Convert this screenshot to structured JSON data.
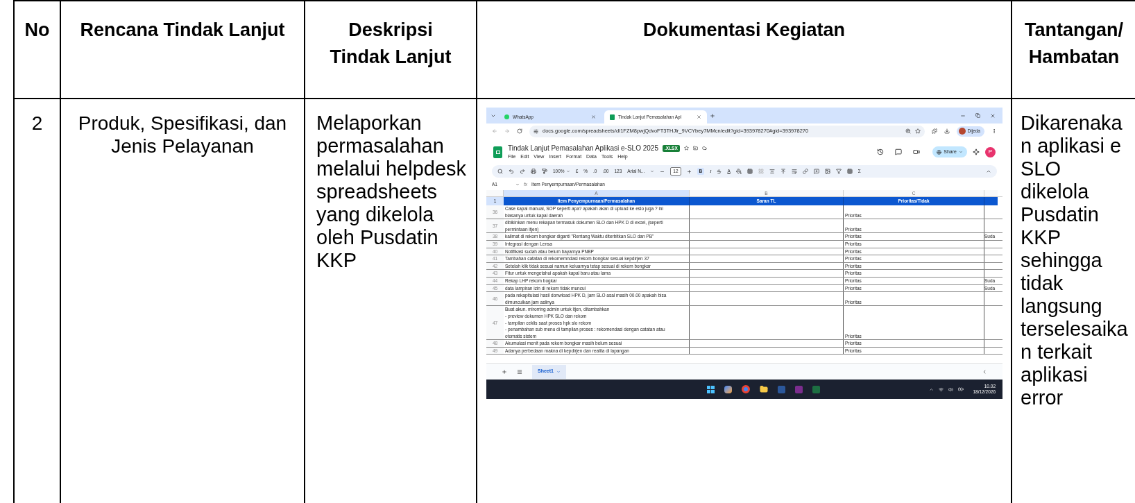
{
  "table": {
    "columns": [
      {
        "label": "No"
      },
      {
        "label": "Rencana Tindak Lanjut"
      },
      {
        "label": "Deskripsi Tindak Lanjut"
      },
      {
        "label": "Dokumentasi Kegiatan"
      },
      {
        "label": "Tantangan/ Hambatan"
      }
    ],
    "rows": [
      {
        "no": "2",
        "rencana": "Produk, Spesifikasi, dan Jenis Pelayanan",
        "deskripsi": "Melaporkan permasalahan melalui helpdesk spreadsheets yang dikelola oleh Pusdatin KKP",
        "tantangan": "Dikarenakan aplikasi e SLO dikelola Pusdatin KKP sehingga tidak langsung terselesaikan terkait aplikasi error",
        "screenshot": {
          "browser_tabs": [
            {
              "title": "WhatsApp",
              "selected": false
            },
            {
              "title": "Tindak Lanjut Pemasalahan Apl",
              "selected": true
            }
          ],
          "url": "docs.google.com/spreadsheets/d/1FZM8pwjQdvoFT3THJlr_9VCYbey7MMcn/edit?gid=393978270#gid=393978270",
          "profile": "Dijeda",
          "doc_title": "Tindak Lanjut Pemasalahan Aplikasi e-SLO 2025",
          "badge": ".XLSX",
          "menu": [
            "File",
            "Edit",
            "View",
            "Insert",
            "Format",
            "Data",
            "Tools",
            "Help"
          ],
          "share": "Share",
          "avatar": "P",
          "toolbar": {
            "zoom": "100%",
            "currency": "£",
            "percent": "%",
            "decrease_decimal": ".0",
            "increase_decimal": ".00",
            "number_format": "123",
            "font": "Arial N...",
            "font_size": "12",
            "bold": "B",
            "italic": "I",
            "text_color": "A",
            "sum": "Σ"
          },
          "cell_ref": "A1",
          "fx": "fx",
          "formula": "Item Penyempurnaan/Permasalahan",
          "column_letters": [
            "A",
            "B",
            "C"
          ],
          "header": {
            "row": "1",
            "cells": [
              "Item Penyempurnaan/Permasalahan",
              "Saran TL",
              "Prioritas/Tidak"
            ]
          },
          "rows": [
            {
              "num": "36",
              "item": "Case kapal manual, SOP seperti apa? apakah akan di upload ke eslo juga ? ini\nbiasanya untuk kapal daerah",
              "priority": "Prioritas"
            },
            {
              "num": "37",
              "item": "dibikinkan menu rekapan termasuk dokumen SLO dan HPK D di excel, (seperti\npermintaan itjen)",
              "priority": "Prioritas"
            },
            {
              "num": "38",
              "item": "kalimat di rekom bongkar diganti \"Rentang Waktu diterbitkan SLO dan PB\"",
              "priority": "Prioritas",
              "column_4": "Suda"
            },
            {
              "num": "39",
              "item": "Integrasi dengan Lensa",
              "priority": "Prioritas"
            },
            {
              "num": "40",
              "item": "Notifikasi sudah atau belum bayarnya PNBP",
              "priority": "Prioritas"
            },
            {
              "num": "41",
              "item": "Tambahan catatan di rekomemndasi rekom bongkar sesuai kepdirjen 37",
              "priority": "Prioritas"
            },
            {
              "num": "42",
              "item": "Setelah klik tidak sesuai namun keluarnya tetap sesuai di rekom bongkar",
              "priority": "Prioritas"
            },
            {
              "num": "43",
              "item": "Fitur untuk mengetahui apakah kapal baru atau lama",
              "priority": "Prioritas"
            },
            {
              "num": "44",
              "item": "Rekap LHP rekom bogkar",
              "priority": "Prioritas",
              "column_4": "Suda"
            },
            {
              "num": "45",
              "item": "data lampiran izin di rekom tidak muncul",
              "priority": "Prioritas",
              "column_4": "Suda"
            },
            {
              "num": "46",
              "item": "pada rekapitulasi hasil donwload HPK D, jam SLO asal masih 00.00 apakah bisa\ndimunculkan jam aslinya",
              "priority": "Prioritas"
            },
            {
              "num": "47",
              "item": "Buat akun. mirorring admin untuk itjen, ditambahkan\n- preview dokumen HPK SLO dan rekom\n- tampilan ceklis saat proses hpk slo rekom\n- penambahan sub menu di tampilan proses : rekomendasi dengan catatan atau\notomatis sistem",
              "priority": "Prioritas"
            },
            {
              "num": "48",
              "item": "Akumulasi menit pada rekom bongkar masih belum sesuai",
              "priority": "Prioritas"
            },
            {
              "num": "49",
              "item": "Adanya perbedaan makna di kepdirjen dan realita di lapangan",
              "priority": "Prioritas"
            }
          ],
          "sheet_tabs": [
            {
              "label": "Sheet1",
              "selected": true
            }
          ],
          "taskbar": {
            "time": "10.02",
            "date": "18/12/2026"
          }
        }
      }
    ]
  }
}
